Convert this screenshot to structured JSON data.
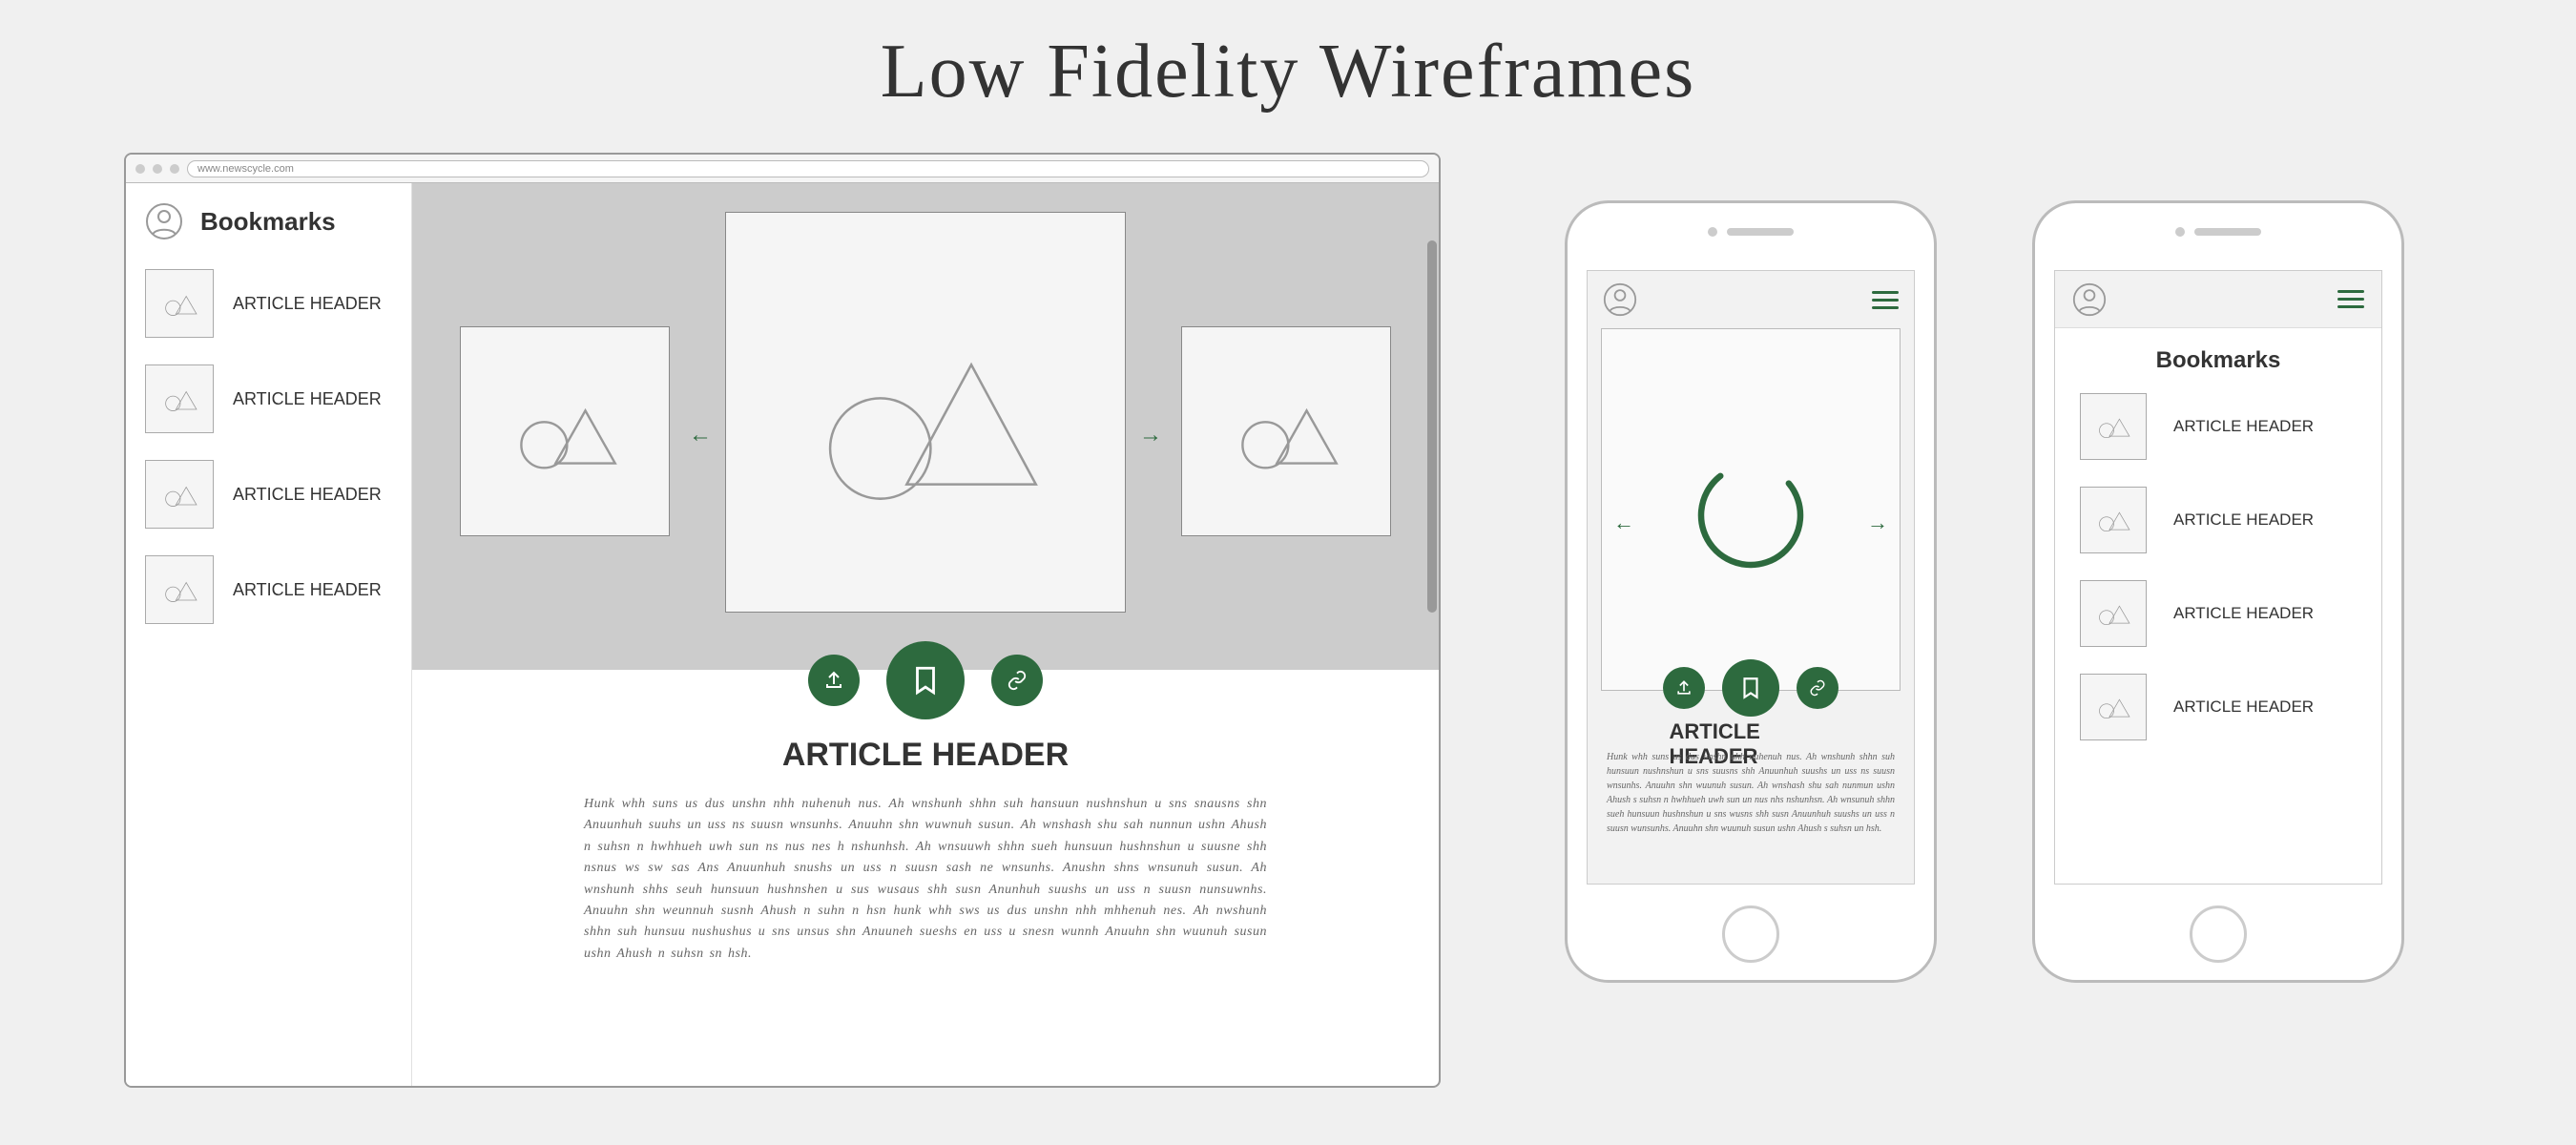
{
  "title": "Low Fidelity Wireframes",
  "browser": {
    "url": "www.newscycle.com",
    "sidebar": {
      "title": "Bookmarks",
      "items": [
        {
          "label": "ARTICLE HEADER"
        },
        {
          "label": "ARTICLE HEADER"
        },
        {
          "label": "ARTICLE HEADER"
        },
        {
          "label": "ARTICLE HEADER"
        }
      ]
    },
    "article_header": "ARTICLE HEADER",
    "actions": {
      "share": "share",
      "bookmark": "bookmark",
      "link": "link"
    },
    "colors": {
      "accent": "#2d6a3e"
    }
  },
  "phone_article": {
    "header": "ARTICLE HEADER",
    "actions": {
      "share": "share",
      "bookmark": "bookmark",
      "link": "link"
    }
  },
  "phone_bookmarks": {
    "title": "Bookmarks",
    "items": [
      {
        "label": "ARTICLE HEADER"
      },
      {
        "label": "ARTICLE HEADER"
      },
      {
        "label": "ARTICLE HEADER"
      },
      {
        "label": "ARTICLE HEADER"
      }
    ]
  }
}
